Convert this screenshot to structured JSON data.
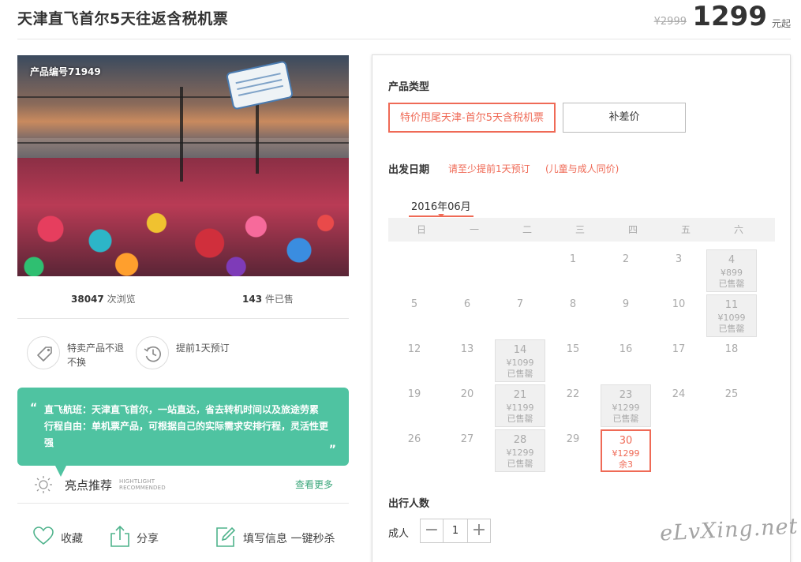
{
  "header": {
    "title": "天津直飞首尔5天往返含税机票",
    "old_price": "¥2999",
    "price": "1299",
    "price_unit": "元起"
  },
  "product": {
    "product_no": "产品编号71949",
    "views_count": "38047",
    "views_label": "次浏览",
    "sold_count": "143",
    "sold_label": "件已售"
  },
  "features": [
    {
      "icon": "tag-icon",
      "text": "特卖产品不退不换"
    },
    {
      "icon": "clock-icon",
      "text": "提前1天预订"
    }
  ],
  "bubble": {
    "text": "直飞航班：天津直飞首尔，一站直达，省去转机时间以及旅途劳累 行程自由：单机票产品，可根据自己的实际需求安排行程，灵活性更强"
  },
  "highlight": {
    "title": "亮点推荐",
    "subtitle_en_1": "HIGHTLIGHT",
    "subtitle_en_2": "RECOMMENDED",
    "more": "查看更多"
  },
  "actions": [
    {
      "icon": "heart-icon",
      "label": "收藏"
    },
    {
      "icon": "share-icon",
      "label": "分享"
    },
    {
      "icon": "edit-icon",
      "label": "填写信息 一键秒杀"
    }
  ],
  "booking": {
    "type_label": "产品类型",
    "types": [
      "特价甩尾天津-首尔5天含税机票",
      "补差价"
    ],
    "date_label": "出发日期",
    "tip1": "请至少提前1天预订",
    "tip2": "(儿童与成人同价)",
    "month": "2016年06月",
    "weekdays": [
      "日",
      "一",
      "二",
      "三",
      "四",
      "五",
      "六"
    ],
    "days": [
      {
        "d": "1",
        "c": 3,
        "r": 0
      },
      {
        "d": "2",
        "c": 4,
        "r": 0
      },
      {
        "d": "3",
        "c": 5,
        "r": 0
      },
      {
        "d": "4",
        "c": 6,
        "r": 0,
        "state": "soldout",
        "price": "¥899",
        "status": "已售罄"
      },
      {
        "d": "5",
        "c": 0,
        "r": 1
      },
      {
        "d": "6",
        "c": 1,
        "r": 1
      },
      {
        "d": "7",
        "c": 2,
        "r": 1
      },
      {
        "d": "8",
        "c": 3,
        "r": 1
      },
      {
        "d": "9",
        "c": 4,
        "r": 1
      },
      {
        "d": "10",
        "c": 5,
        "r": 1
      },
      {
        "d": "11",
        "c": 6,
        "r": 1,
        "state": "soldout",
        "price": "¥1099",
        "status": "已售罄"
      },
      {
        "d": "12",
        "c": 0,
        "r": 2
      },
      {
        "d": "13",
        "c": 1,
        "r": 2
      },
      {
        "d": "14",
        "c": 2,
        "r": 2,
        "state": "soldout",
        "price": "¥1099",
        "status": "已售罄"
      },
      {
        "d": "15",
        "c": 3,
        "r": 2
      },
      {
        "d": "16",
        "c": 4,
        "r": 2
      },
      {
        "d": "17",
        "c": 5,
        "r": 2
      },
      {
        "d": "18",
        "c": 6,
        "r": 2
      },
      {
        "d": "19",
        "c": 0,
        "r": 3
      },
      {
        "d": "20",
        "c": 1,
        "r": 3
      },
      {
        "d": "21",
        "c": 2,
        "r": 3,
        "state": "soldout",
        "price": "¥1199",
        "status": "已售罄"
      },
      {
        "d": "22",
        "c": 3,
        "r": 3
      },
      {
        "d": "23",
        "c": 4,
        "r": 3,
        "state": "soldout",
        "price": "¥1299",
        "status": "已售罄"
      },
      {
        "d": "24",
        "c": 5,
        "r": 3
      },
      {
        "d": "25",
        "c": 6,
        "r": 3
      },
      {
        "d": "26",
        "c": 0,
        "r": 4
      },
      {
        "d": "27",
        "c": 1,
        "r": 4
      },
      {
        "d": "28",
        "c": 2,
        "r": 4,
        "state": "soldout",
        "price": "¥1299",
        "status": "已售罄"
      },
      {
        "d": "29",
        "c": 3,
        "r": 4
      },
      {
        "d": "30",
        "c": 4,
        "r": 4,
        "state": "selected",
        "price": "¥1299",
        "status": "余3"
      }
    ],
    "people_label": "出行人数",
    "adult_label": "成人",
    "qty": "1",
    "minus": "−",
    "plus": "+"
  },
  "watermark": "eLvXing.net",
  "colors": {
    "accent": "#ef6a56",
    "green": "#4fc3a1",
    "link": "#3aa67a"
  }
}
